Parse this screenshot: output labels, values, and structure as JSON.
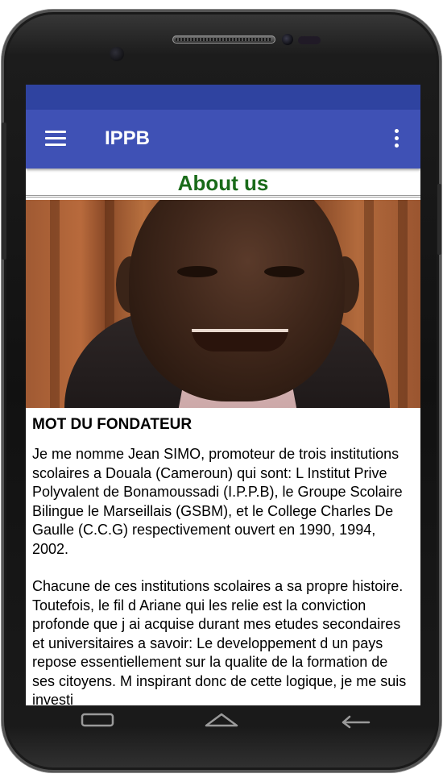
{
  "toolbar": {
    "title": "IPPB",
    "menu_icon": "hamburger-menu-icon",
    "overflow_icon": "more-vertical-icon"
  },
  "page": {
    "heading": "About us",
    "heading_color": "#1a6b1a"
  },
  "content": {
    "section_title": "MOT DU FONDATEUR",
    "paragraphs": [
      "Je me nomme Jean SIMO, promoteur de trois institutions scolaires a Douala (Cameroun) qui sont: L Institut Prive Polyvalent de Bonamoussadi (I.P.P.B), le Groupe Scolaire Bilingue le Marseillais (GSBM), et le College Charles De Gaulle (C.C.G) respectivement ouvert en 1990, 1994, 2002.",
      "Chacune de ces institutions scolaires a sa propre histoire. Toutefois, le fil d Ariane qui les relie est la conviction profonde que j ai acquise durant mes etudes secondaires et universitaires a savoir: Le developpement d un pays repose essentiellement sur la qualite de la formation de ses citoyens. M inspirant donc de cette logique, je me suis investi"
    ]
  },
  "colors": {
    "status_bar": "#2f43a0",
    "toolbar": "#3f51b5"
  },
  "hardware_keys": {
    "back_icon": "back-key-icon",
    "home_icon": "home-key-icon",
    "recent_icon": "recent-apps-key-icon"
  }
}
